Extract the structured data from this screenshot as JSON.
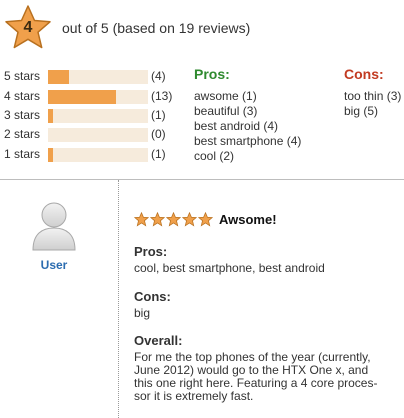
{
  "summary": {
    "average_rating": "4",
    "text": "out of 5 (based on 19 reviews)",
    "star_color": "#f0a04b"
  },
  "rating_breakdown": [
    {
      "label": "5 stars",
      "count": "(4)",
      "fraction": 0.21
    },
    {
      "label": "4 stars",
      "count": "(13)",
      "fraction": 0.68
    },
    {
      "label": "3 stars",
      "count": "(1)",
      "fraction": 0.05
    },
    {
      "label": "2 stars",
      "count": "(0)",
      "fraction": 0
    },
    {
      "label": "1 stars",
      "count": "(1)",
      "fraction": 0.05
    }
  ],
  "pros": {
    "heading": "Pros:",
    "color": "#2f8a2f",
    "items": [
      "awsome (1)",
      "beautiful (3)",
      "best android (4)",
      "best smartphone (4)",
      "cool (2)"
    ]
  },
  "cons": {
    "heading": "Cons:",
    "color": "#c23b22",
    "items": [
      "too thin (3)",
      "big (5)"
    ]
  },
  "review": {
    "user": "User",
    "stars": 5,
    "title": "Awsome!",
    "pros_label": "Pros:",
    "pros_text": "cool, best smartphone, best android",
    "cons_label": "Cons:",
    "cons_text": "big",
    "overall_label": "Overall:",
    "overall_lines": [
      "For me the top phones of the year (currently,",
      "June 2012) would go to the HTX One x, and",
      "this one right here. Featuring a 4 core proces-",
      "sor it is extremely fast."
    ]
  }
}
